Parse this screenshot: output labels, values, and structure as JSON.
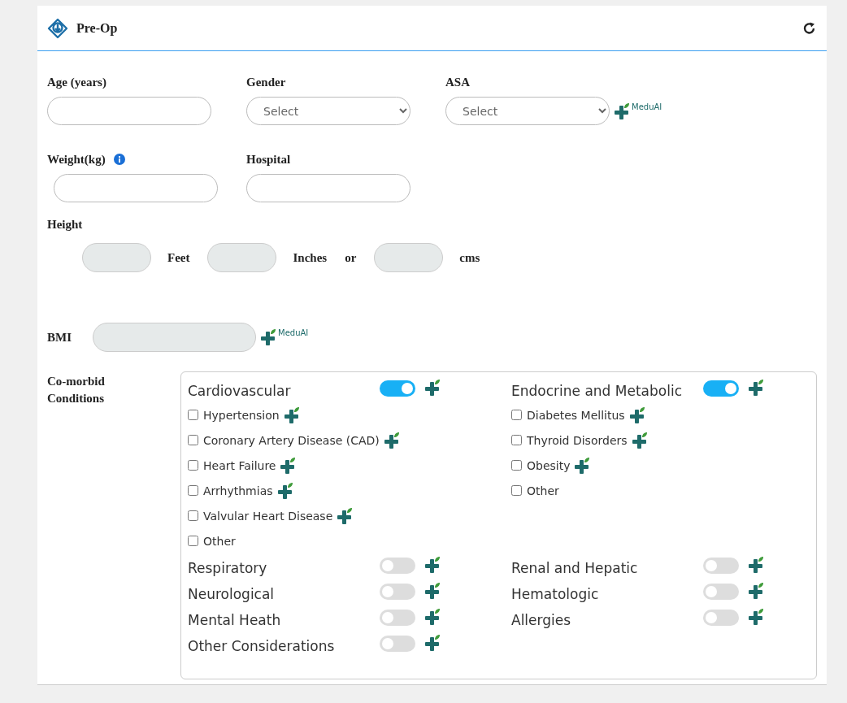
{
  "panel": {
    "title": "Pre-Op"
  },
  "fields": [
    {
      "kind": "text",
      "label": "Age (years)"
    },
    {
      "kind": "select",
      "label": "Gender",
      "value": "Select"
    },
    {
      "kind": "select",
      "label": "ASA",
      "value": "Select",
      "logo": "MeduAI"
    },
    {
      "kind": "text",
      "label": "Weight(kg)",
      "info": true
    },
    {
      "kind": "text",
      "label": "Hospital"
    }
  ],
  "height": {
    "label": "Height",
    "units": [
      {
        "label": "Feet"
      },
      {
        "label": "Inches",
        "suffix": "or"
      },
      {
        "label": "cms"
      }
    ]
  },
  "bmi": {
    "label": "BMI",
    "logo": "MeduAI"
  },
  "comorbid": {
    "label": "Co-morbid Conditions",
    "categories": [
      {
        "name": "Cardiovascular",
        "on": true,
        "items": [
          {
            "label": "Hypertension",
            "checked": false,
            "ai_icon": true
          },
          {
            "label": "Coronary Artery Disease (CAD)",
            "checked": false,
            "ai_icon": true
          },
          {
            "label": "Heart Failure",
            "checked": false,
            "ai_icon": true
          },
          {
            "label": "Arrhythmias",
            "checked": false,
            "ai_icon": true
          },
          {
            "label": "Valvular Heart Disease",
            "checked": false,
            "ai_icon": true
          },
          {
            "label": "Other",
            "checked": false,
            "ai_icon": false
          }
        ]
      },
      {
        "name": "Endocrine and Metabolic",
        "on": true,
        "items": [
          {
            "label": "Diabetes Mellitus",
            "checked": false,
            "ai_icon": true
          },
          {
            "label": "Thyroid Disorders",
            "checked": false,
            "ai_icon": true
          },
          {
            "label": "Obesity",
            "checked": false,
            "ai_icon": true
          },
          {
            "label": "Other",
            "checked": false,
            "ai_icon": false
          }
        ]
      },
      {
        "name": "Respiratory",
        "on": false
      },
      {
        "name": "Renal and Hepatic",
        "on": false
      },
      {
        "name": "Neurological",
        "on": false
      },
      {
        "name": "Hematologic",
        "on": false
      },
      {
        "name": "Mental Heath",
        "on": false
      },
      {
        "name": "Allergies",
        "on": false
      },
      {
        "name": "Other Considerations",
        "on": false
      }
    ]
  }
}
